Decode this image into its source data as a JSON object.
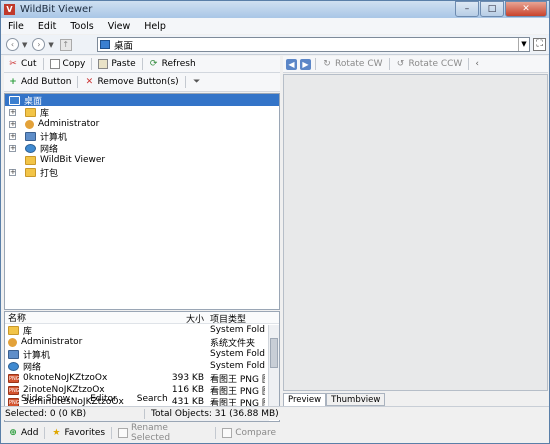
{
  "window": {
    "title": "WildBit Viewer",
    "app_icon_letter": "V"
  },
  "menu": [
    "File",
    "Edit",
    "Tools",
    "View",
    "Help"
  ],
  "address": {
    "value": "桌面"
  },
  "file_toolbar": {
    "cut": "Cut",
    "copy": "Copy",
    "paste": "Paste",
    "refresh": "Refresh"
  },
  "fav_toolbar": {
    "add": "Add Button",
    "remove": "Remove Button(s)"
  },
  "tree": {
    "root": "桌面",
    "items": [
      "库",
      "Administrator",
      "计算机",
      "网络",
      "WildBit Viewer",
      "打包"
    ]
  },
  "list": {
    "headers": [
      "名称",
      "大小",
      "项目类型"
    ],
    "rows": [
      {
        "name": "库",
        "size": "",
        "type": "System Folder",
        "icon": "folder"
      },
      {
        "name": "Administrator",
        "size": "",
        "type": "系统文件夹",
        "icon": "user"
      },
      {
        "name": "计算机",
        "size": "",
        "type": "System Folder",
        "icon": "pc"
      },
      {
        "name": "网络",
        "size": "",
        "type": "System Folder",
        "icon": "net"
      },
      {
        "name": "0knoteNoJKZtzoOx",
        "size": "393 KB",
        "type": "看图王 PNG 图",
        "icon": "png"
      },
      {
        "name": "2inoteNoJKZtzoOx",
        "size": "116 KB",
        "type": "看图王 PNG 图",
        "icon": "png"
      },
      {
        "name": "3eminutesNoJKZtzoOx",
        "size": "431 KB",
        "type": "看图王 PNG 图",
        "icon": "png"
      }
    ]
  },
  "bottom_toolbar": {
    "add": "Add",
    "favorites": "Favorites",
    "rename": "Rename Selected",
    "compare": "Compare"
  },
  "left_tabs": [
    "Slide Show",
    "Editor",
    "Search"
  ],
  "viewer_toolbar": {
    "rotate_cw": "Rotate CW",
    "rotate_ccw": "Rotate CCW"
  },
  "right_tabs": [
    "Preview",
    "Thumbview"
  ],
  "status": {
    "selected": "Selected: 0 (0 KB)",
    "total": "Total Objects: 31 (36.88 MB)"
  }
}
